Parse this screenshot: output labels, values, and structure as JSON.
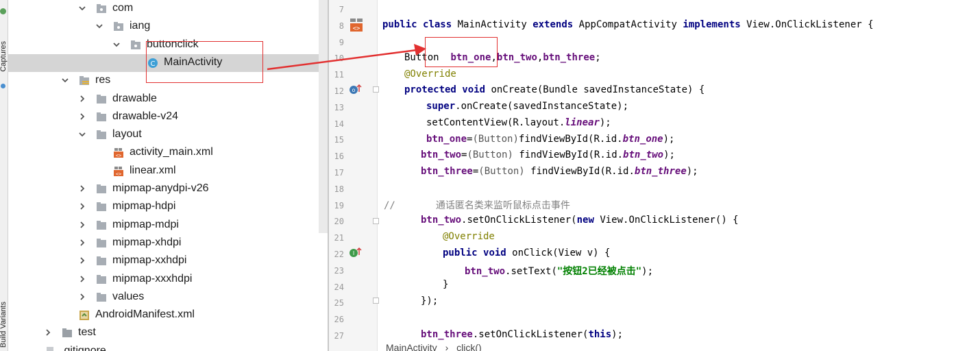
{
  "toolstrip": {
    "top_label": "Captures",
    "bottom_label": "Build Variants"
  },
  "tree": {
    "items": [
      {
        "label": "com",
        "type": "package",
        "arrow": "down"
      },
      {
        "label": "iang",
        "type": "package",
        "arrow": "down"
      },
      {
        "label": "buttonclick",
        "type": "package",
        "arrow": "down"
      },
      {
        "label": "MainActivity",
        "type": "class",
        "arrow": "none",
        "selected": true
      },
      {
        "label": "res",
        "type": "res-folder",
        "arrow": "down"
      },
      {
        "label": "drawable",
        "type": "folder",
        "arrow": "right"
      },
      {
        "label": "drawable-v24",
        "type": "folder",
        "arrow": "right"
      },
      {
        "label": "layout",
        "type": "folder",
        "arrow": "down"
      },
      {
        "label": "activity_main.xml",
        "type": "xml",
        "arrow": "none"
      },
      {
        "label": "linear.xml",
        "type": "xml",
        "arrow": "none"
      },
      {
        "label": "mipmap-anydpi-v26",
        "type": "folder",
        "arrow": "right"
      },
      {
        "label": "mipmap-hdpi",
        "type": "folder",
        "arrow": "right"
      },
      {
        "label": "mipmap-mdpi",
        "type": "folder",
        "arrow": "right"
      },
      {
        "label": "mipmap-xhdpi",
        "type": "folder",
        "arrow": "right"
      },
      {
        "label": "mipmap-xxhdpi",
        "type": "folder",
        "arrow": "right"
      },
      {
        "label": "mipmap-xxxhdpi",
        "type": "folder",
        "arrow": "right"
      },
      {
        "label": "values",
        "type": "folder",
        "arrow": "right"
      },
      {
        "label": "AndroidManifest.xml",
        "type": "manifest",
        "arrow": "none"
      },
      {
        "label": "test",
        "type": "folder-gray",
        "arrow": "right"
      },
      {
        "label": ".gitignore",
        "type": "file",
        "arrow": "none"
      }
    ]
  },
  "editor": {
    "line_numbers": [
      "7",
      "8",
      "9",
      "10",
      "11",
      "12",
      "13",
      "14",
      "15",
      "16",
      "17",
      "18",
      "19",
      "20",
      "21",
      "22",
      "23",
      "24",
      "25",
      "26",
      "27"
    ],
    "code": {
      "l8_kw1": "public",
      "l8_kw2": "class",
      "l8_name": "MainActivity",
      "l8_kw3": "extends",
      "l8_parent": "AppCompatActivity",
      "l8_kw4": "implements",
      "l8_iface": "View.OnClickListener {",
      "l10_type": "Button  ",
      "l10_f1": "btn_one",
      "l10_f2": "btn_two",
      "l10_f3": "btn_three",
      "comma": ",",
      "semi": ";",
      "l11_ann": "@Override",
      "l12_kw1": "protected",
      "l12_kw2": "void",
      "l12_rest": "onCreate(Bundle savedInstanceState) {",
      "l13_kw": "super",
      "l13_rest": ".onCreate(savedInstanceState);",
      "l14_pre": "setContentView(R.layout.",
      "l14_f": "linear",
      "l14_post": ");",
      "l15_f": "btn_one",
      "l16_f": "btn_two",
      "l17_f": "btn_three",
      "eq": "=",
      "cast": "(Button)",
      "find": "findViewById(R.id.",
      "close": ");",
      "l19_cmt": "//       通话匿名类来监听鼠标点击事件",
      "l20_f": "btn_two",
      "l20_mid": ".setOnClickListener(",
      "l20_kw": "new",
      "l20_rest": " View.OnClickListener() {",
      "l21_ann": "@Override",
      "l22_kw1": "public",
      "l22_kw2": "void",
      "l22_rest": "onClick(View v) {",
      "l23_f": "btn_two",
      "l23_mid": ".setText(",
      "l23_str": "\"按钮2已经被点击\"",
      "l23_post": ");",
      "l24": "}",
      "l25": "});",
      "l27_f": "btn_three",
      "l27_mid": ".setOnClickListener(",
      "l27_kw": "this",
      "l27_post": ");"
    },
    "breadcrumb": {
      "class": "MainActivity",
      "sep": "›",
      "method": "click()"
    }
  },
  "colors": {
    "annotation_red": "#e23030",
    "keyword": "#000080",
    "field": "#660e7a",
    "string": "#008000",
    "annotation": "#808000"
  }
}
